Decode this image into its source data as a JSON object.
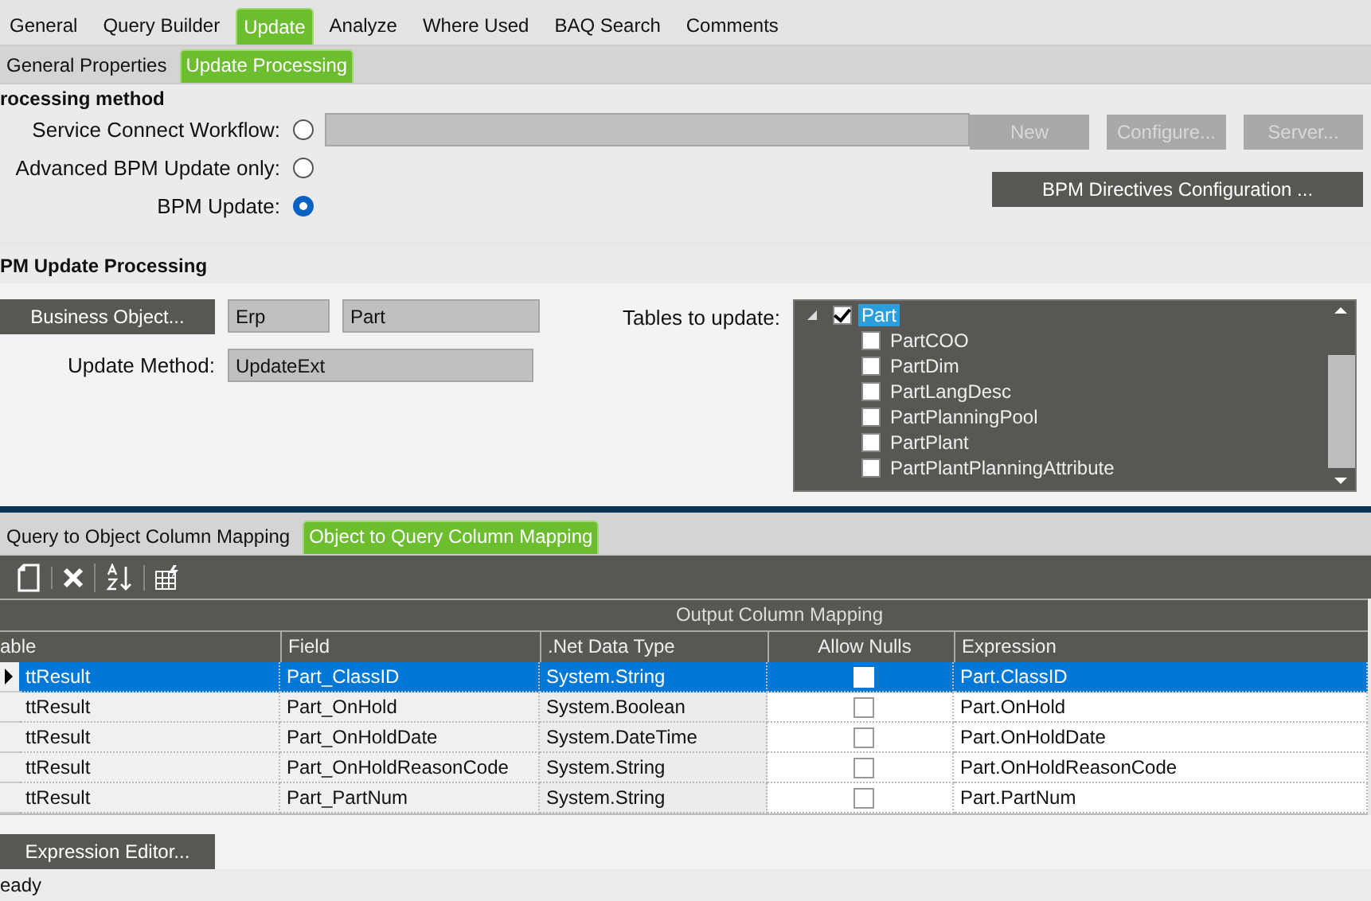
{
  "tabs": [
    {
      "label": "General",
      "selected": false
    },
    {
      "label": "Query Builder",
      "selected": false
    },
    {
      "label": "Update",
      "selected": true
    },
    {
      "label": "Analyze",
      "selected": false
    },
    {
      "label": "Where Used",
      "selected": false
    },
    {
      "label": "BAQ Search",
      "selected": false
    },
    {
      "label": "Comments",
      "selected": false
    }
  ],
  "subtabs": [
    {
      "label": "General Properties",
      "selected": false
    },
    {
      "label": "Update  Processing",
      "selected": true
    }
  ],
  "processing_method": {
    "title": "rocessing method",
    "options": [
      {
        "label": "Service Connect Workflow:",
        "selected": false,
        "kind": "with_field"
      },
      {
        "label": "Advanced BPM Update only:",
        "selected": false,
        "kind": "plain"
      },
      {
        "label": "BPM Update:",
        "selected": true,
        "kind": "plain"
      }
    ],
    "buttons": [
      {
        "label": "New",
        "disabled": true
      },
      {
        "label": "Configure...",
        "disabled": true
      },
      {
        "label": "Server...",
        "disabled": true
      }
    ],
    "directives_button": "BPM Directives Configuration ..."
  },
  "bpm_update_processing": {
    "title": "PM Update Processing",
    "business_object_button": "Business Object...",
    "bo_service_prefix": "Erp",
    "bo_service": "Part",
    "update_method_label": "Update Method:",
    "update_method": "UpdateExt",
    "tables_label": "Tables to update:",
    "tables": [
      {
        "label": "Part",
        "checked": true,
        "selected": true,
        "expanded": true,
        "children": [
          {
            "label": "PartCOO",
            "checked": false,
            "selected": false
          },
          {
            "label": "PartDim",
            "checked": false,
            "selected": false
          },
          {
            "label": "PartLangDesc",
            "checked": false,
            "selected": false
          },
          {
            "label": "PartPlanningPool",
            "checked": false,
            "selected": false
          },
          {
            "label": "PartPlant",
            "checked": false,
            "selected": false
          },
          {
            "label": "PartPlantPlanningAttribute",
            "checked": false,
            "selected": false
          }
        ]
      }
    ]
  },
  "mapping_tabs": [
    {
      "label": "Query to Object Column Mapping",
      "selected": false
    },
    {
      "label": "Object to Query Column Mapping",
      "selected": true
    }
  ],
  "grid": {
    "band": "Output Column Mapping",
    "columns": [
      "able",
      "Field",
      ".Net Data Type",
      "Allow Nulls",
      "Expression"
    ],
    "rows": [
      {
        "table": "ttResult",
        "field": "Part_ClassID",
        "type": "System.String",
        "allow_nulls": false,
        "expression": "Part.ClassID",
        "selected": true
      },
      {
        "table": "ttResult",
        "field": "Part_OnHold",
        "type": "System.Boolean",
        "allow_nulls": false,
        "expression": "Part.OnHold",
        "selected": false
      },
      {
        "table": "ttResult",
        "field": "Part_OnHoldDate",
        "type": "System.DateTime",
        "allow_nulls": false,
        "expression": "Part.OnHoldDate",
        "selected": false
      },
      {
        "table": "ttResult",
        "field": "Part_OnHoldReasonCode",
        "type": "System.String",
        "allow_nulls": false,
        "expression": "Part.OnHoldReasonCode",
        "selected": false
      },
      {
        "table": "ttResult",
        "field": "Part_PartNum",
        "type": "System.String",
        "allow_nulls": false,
        "expression": "Part.PartNum",
        "selected": false
      }
    ]
  },
  "expression_editor_button": "Expression Editor...",
  "status_bar": "eady"
}
